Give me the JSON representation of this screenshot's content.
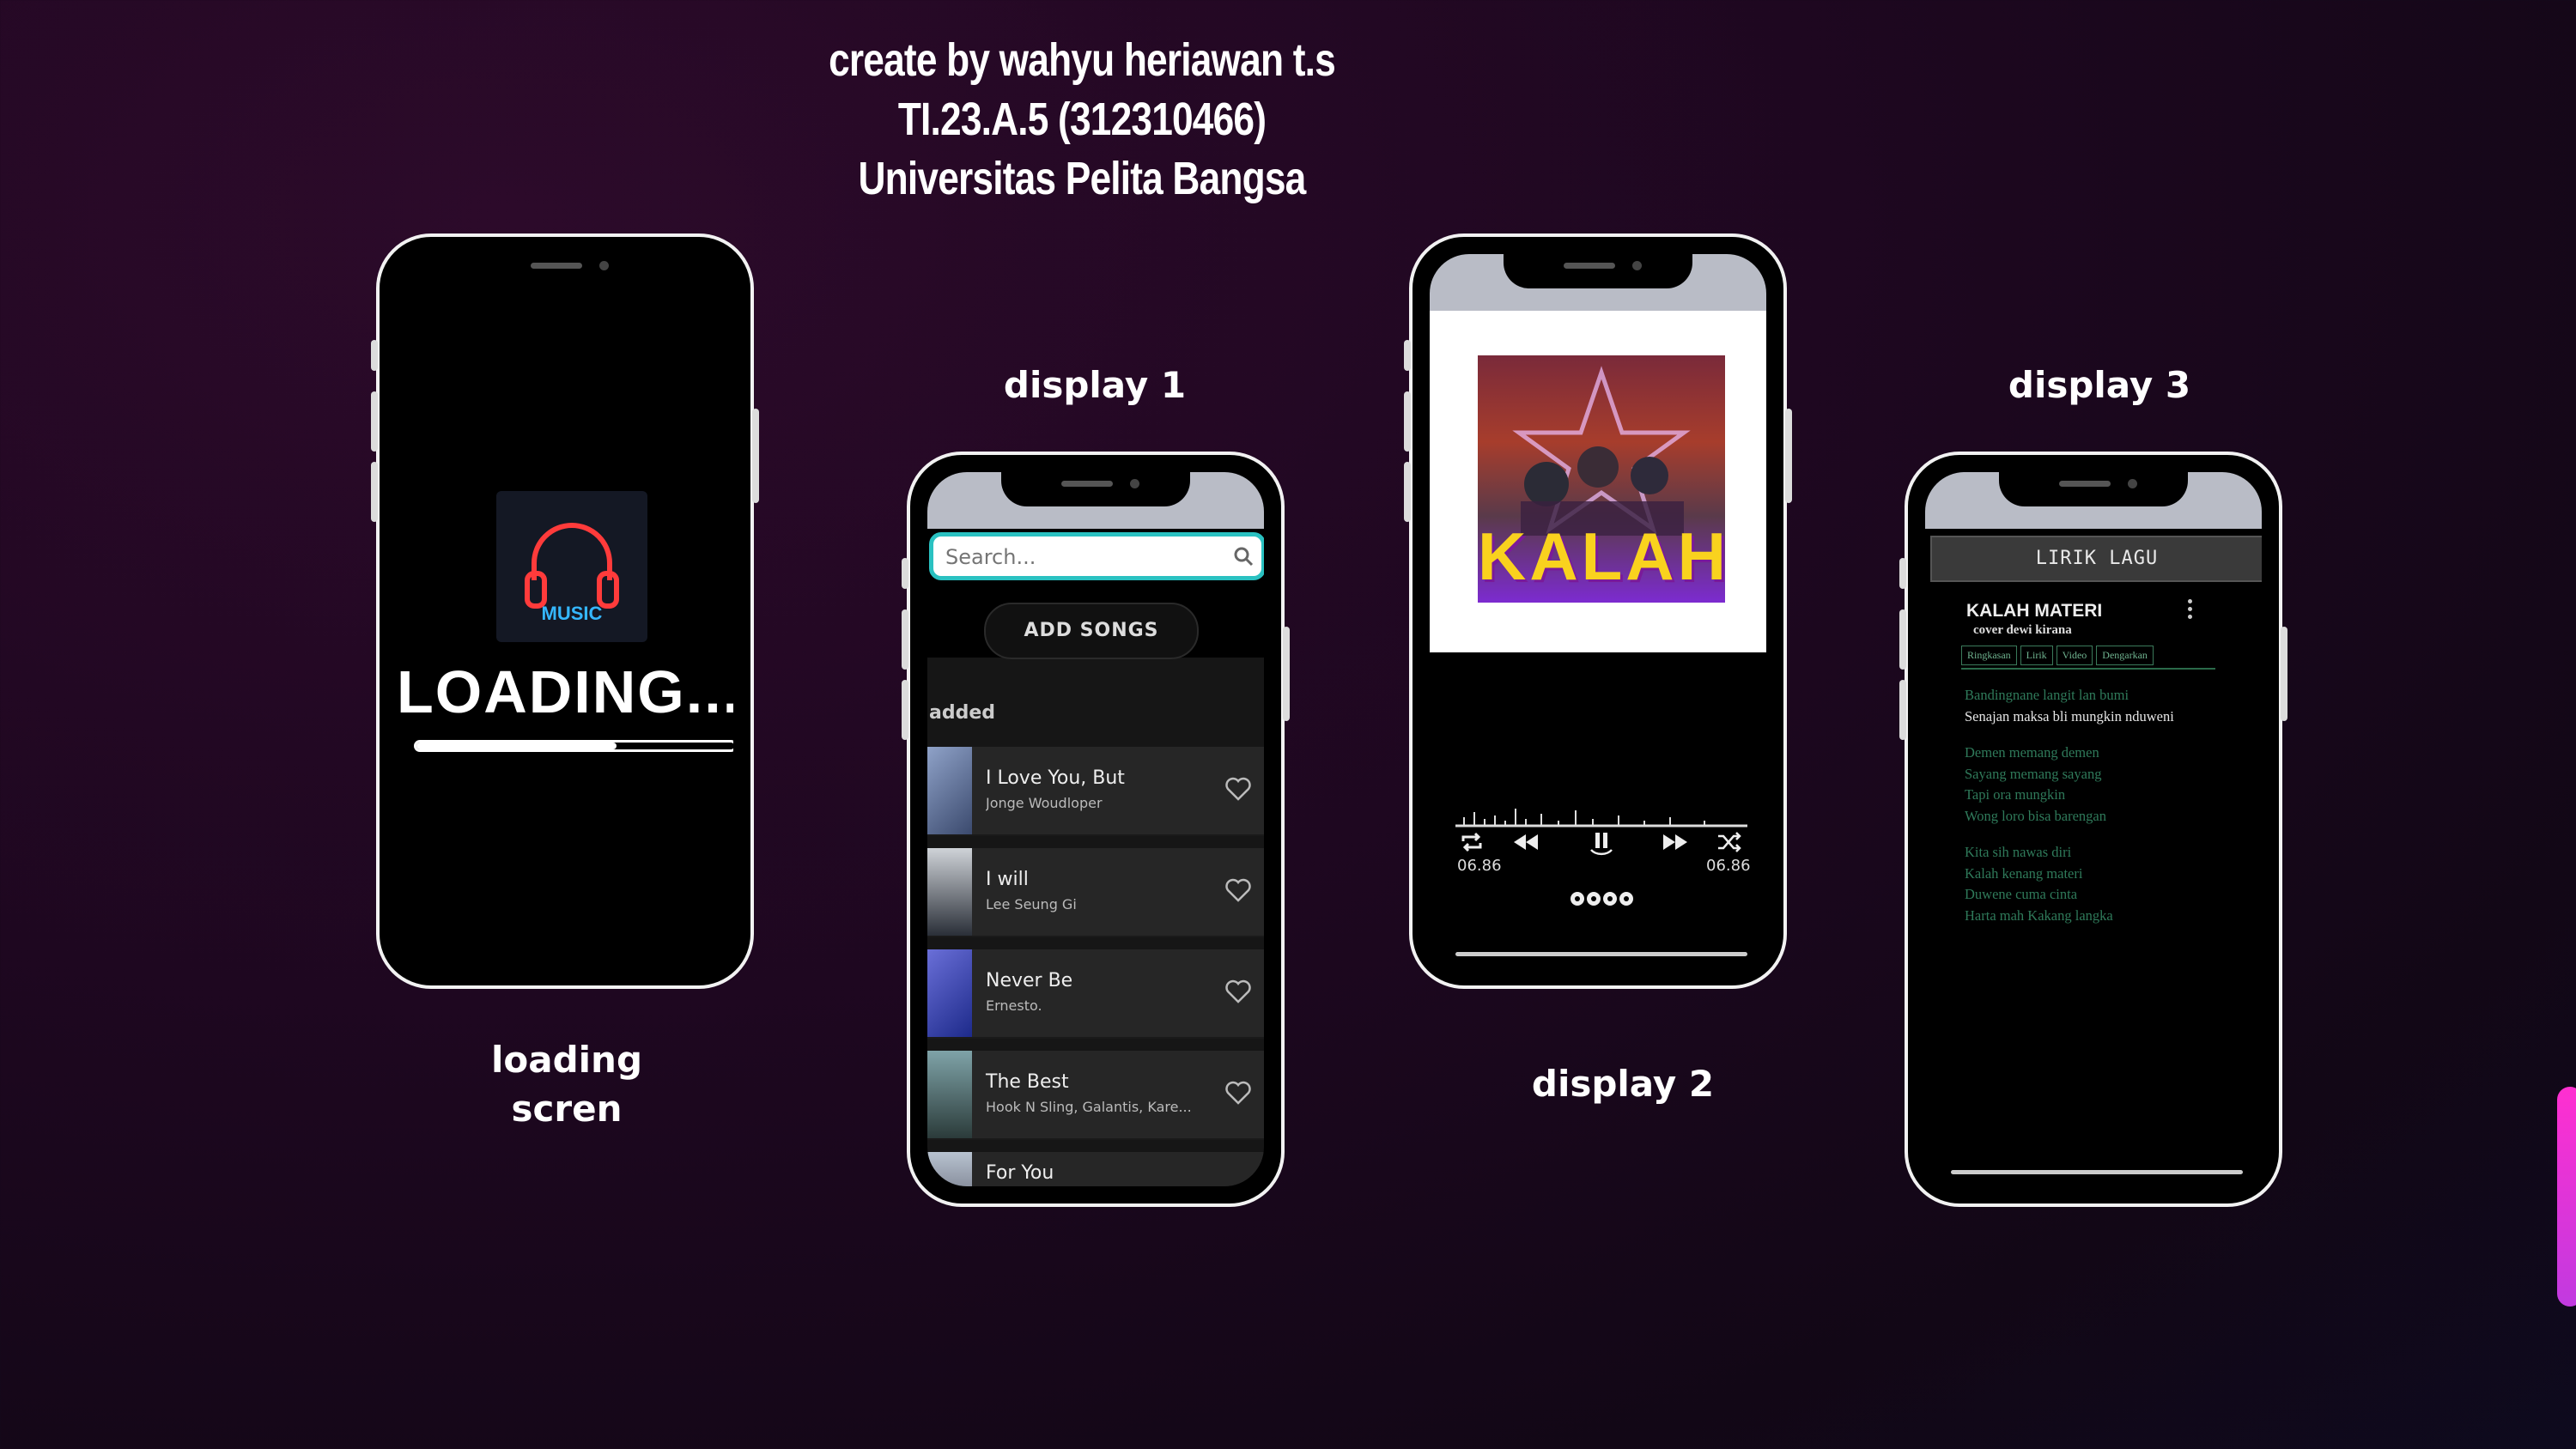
{
  "header": {
    "line1": "create by wahyu heriawan t.s",
    "line2": "TI.23.A.5 (312310466)",
    "line3": "Universitas Pelita Bangsa"
  },
  "captions": {
    "loading_line1": "loading",
    "loading_line2": "scren",
    "display1": "display 1",
    "display2": "display 2",
    "display3": "display 3"
  },
  "loading_screen": {
    "logo_text": "MUSIC",
    "loading_text": "LOADING...",
    "progress": 0.63,
    "logo_color": "#ff3b3b",
    "logo_accent": "#35b7ff"
  },
  "display1": {
    "search_placeholder": "Search...",
    "add_songs_label": "ADD SONGS",
    "section_label": "added",
    "songs": [
      {
        "title": "I Love You, But",
        "artist": "Jonge Woudloper"
      },
      {
        "title": "I will",
        "artist": "Lee Seung Gi"
      },
      {
        "title": "Never Be",
        "artist": "Ernesto."
      },
      {
        "title": "The Best",
        "artist": "Hook N Sling, Galantis, Kare..."
      },
      {
        "title": "For You",
        "artist": ""
      }
    ],
    "accent": "#2ac1c1"
  },
  "display2": {
    "album_title": "KALAH",
    "time_elapsed": "06.86",
    "time_total": "06.86"
  },
  "display3": {
    "header_bar": "LIRIK LAGU",
    "song_title": "KALAH MATERI",
    "song_subtitle": "cover dewi kirana",
    "tabs": [
      "Ringkasan",
      "Lirik",
      "Video",
      "Dengarkan"
    ],
    "lyrics": [
      [
        "Bandingnane langit lan bumi",
        "Senajan maksa bli mungkin nduweni"
      ],
      [
        "Demen memang demen",
        "Sayang memang sayang",
        "Tapi ora mungkin",
        "Wong loro bisa barengan"
      ],
      [
        "Kita sih nawas diri",
        "Kalah kenang materi",
        "Duwene cuma cinta",
        "Harta mah Kakang langka"
      ]
    ]
  }
}
